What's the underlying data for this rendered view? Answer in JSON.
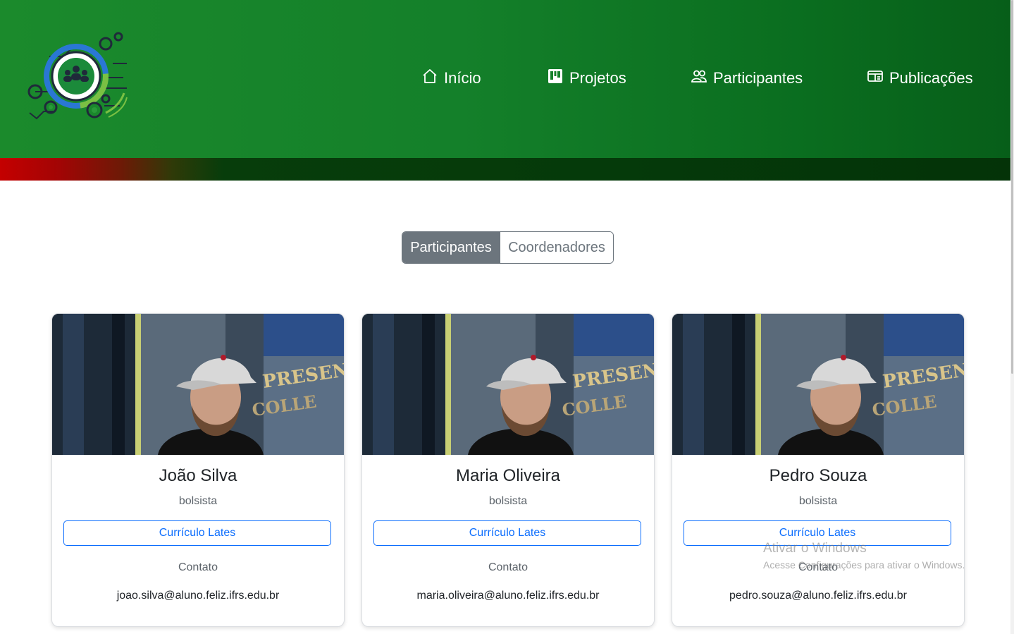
{
  "header": {
    "logo_icon": "gear-people-logo",
    "colors": {
      "green": "#14802a",
      "dark_green": "#053a0a",
      "red": "#c40000"
    },
    "nav": [
      {
        "label": "Início",
        "icon": "home-icon"
      },
      {
        "label": "Projetos",
        "icon": "kanban-icon"
      },
      {
        "label": "Participantes",
        "icon": "people-icon"
      },
      {
        "label": "Publicações",
        "icon": "card-icon"
      }
    ]
  },
  "toggle": {
    "active_label": "Participantes",
    "inactive_label": "Coordenadores"
  },
  "cards": [
    {
      "name": "João Silva",
      "role": "bolsista",
      "button": "Currículo Lates",
      "contact_label": "Contato",
      "email": "joao.silva@aluno.feliz.ifrs.edu.br"
    },
    {
      "name": "Maria Oliveira",
      "role": "bolsista",
      "button": "Currículo Lates",
      "contact_label": "Contato",
      "email": "maria.oliveira@aluno.feliz.ifrs.edu.br"
    },
    {
      "name": "Pedro Souza",
      "role": "bolsista",
      "button": "Currículo Lates",
      "contact_label": "Contato",
      "email": "pedro.souza@aluno.feliz.ifrs.edu.br"
    }
  ],
  "watermark": {
    "title": "Ativar o Windows",
    "subtitle": "Acesse Configurações para ativar o Windows."
  }
}
